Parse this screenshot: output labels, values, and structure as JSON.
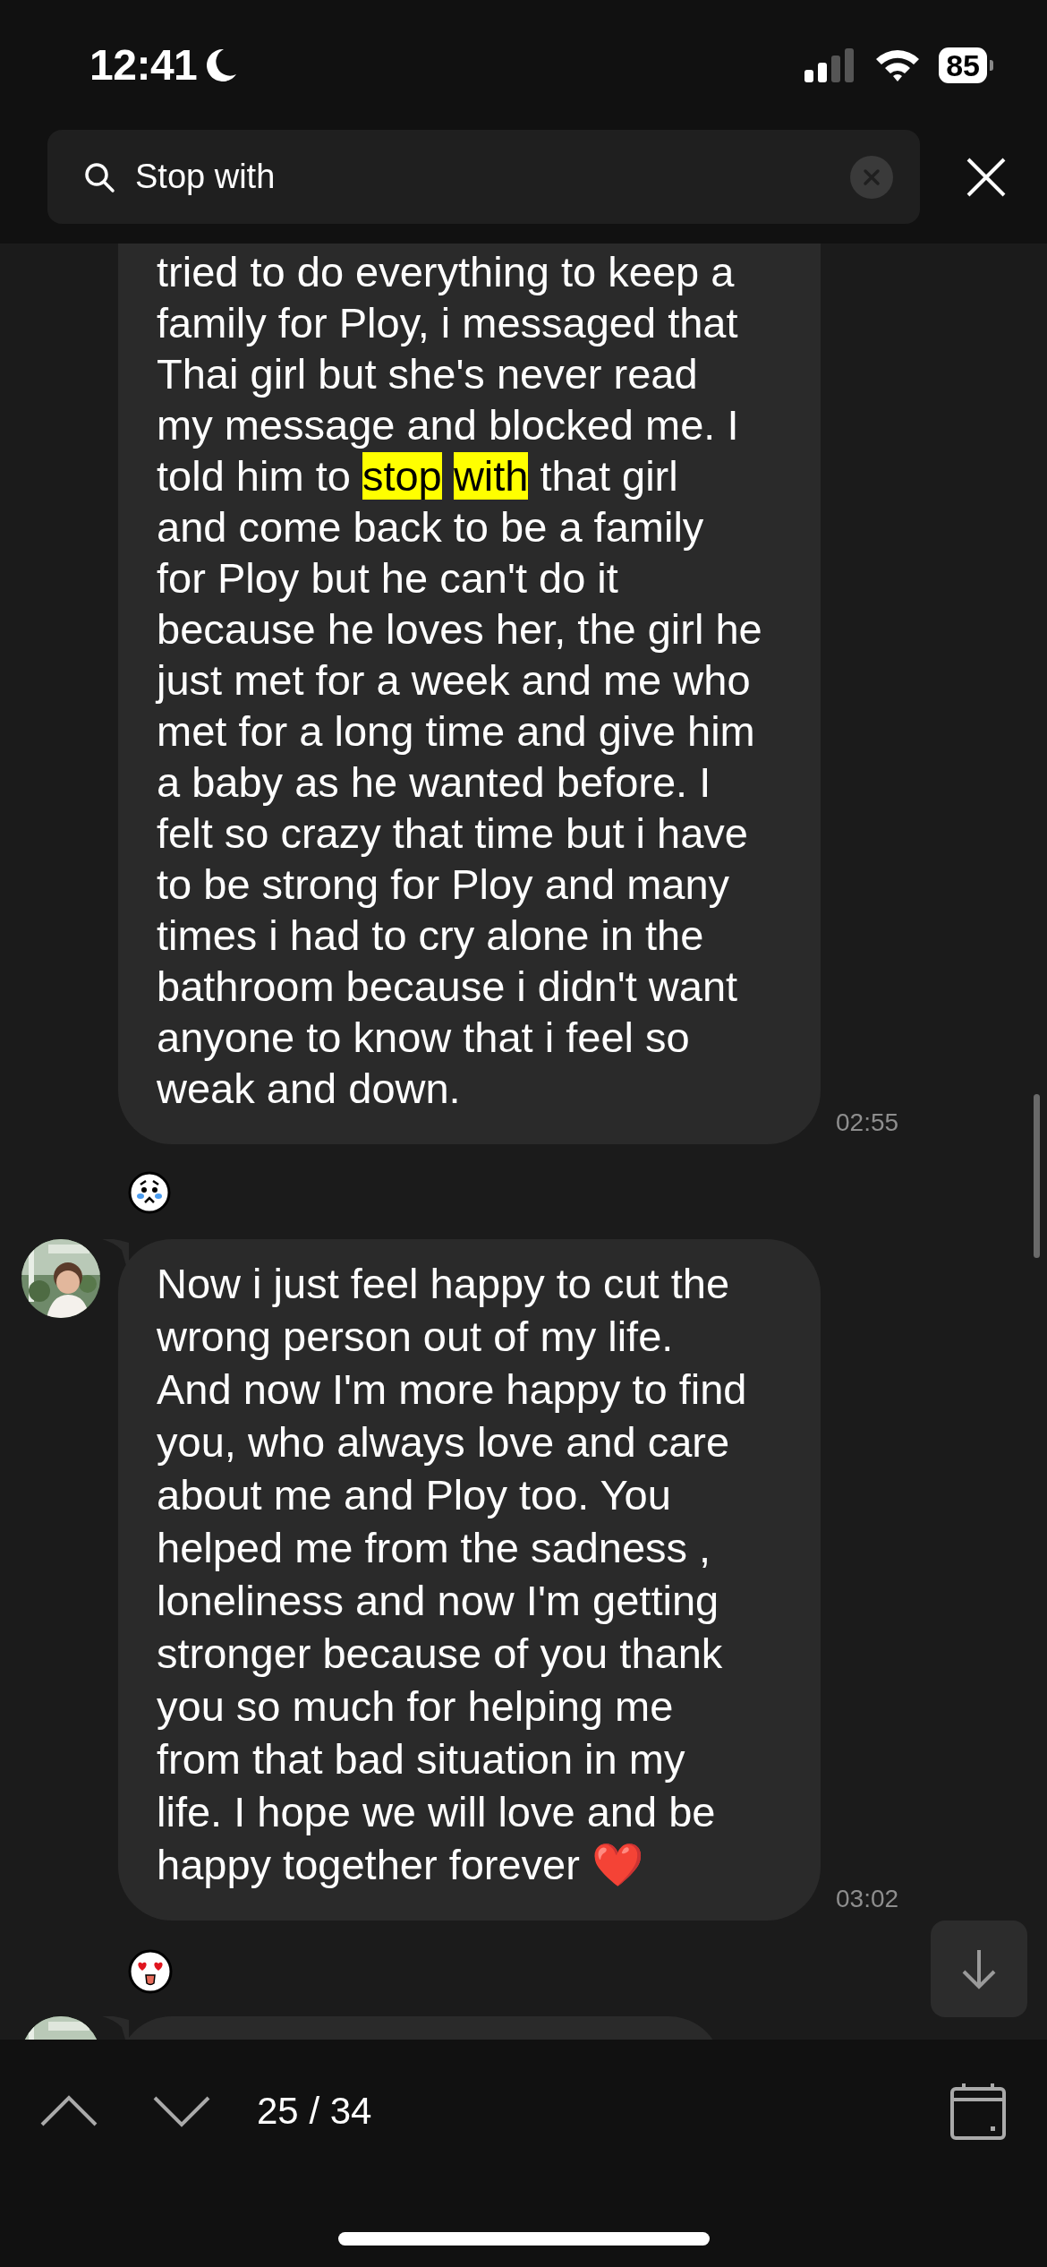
{
  "status_bar": {
    "time": "12:41",
    "battery": "85"
  },
  "search": {
    "value": "Stop with"
  },
  "messages": [
    {
      "kind": "full",
      "avatar": false,
      "time": "02:55",
      "reaction": {
        "kind": "crying"
      },
      "segments": [
        {
          "text": "tried to do everything to keep a\nfamily for Ploy, i messaged that\nThai girl but she's never read\nmy message and blocked me. I\ntold him to ",
          "highlighted": false
        },
        {
          "text": "stop",
          "highlighted": true
        },
        {
          "text": "with",
          "highlighted": true
        },
        {
          "text": " that girl\nand come back to be a family\nfor Ploy but he can't do it\nbecause he loves her, the girl he\njust met for a week and me who\nmet for a long time and give him\na baby as he wanted before. I\nfelt so crazy that time but i have\nto be strong for Ploy and many\ntimes i had to cry alone in the\nbathroom because i didn't want\nanyone to know that i feel so\nweak and down.",
          "highlighted": false
        }
      ]
    },
    {
      "kind": "full",
      "avatar": true,
      "time": "03:02",
      "reaction": {
        "kind": "heart_eyes"
      },
      "segments": [
        {
          "text": "Now i just feel happy to cut the\nwrong person out of my life.\nAnd now I'm more happy to find\nyou, who always love and care\nabout me and Ploy too. You\nhelped me from the sadness ,\nloneliness and now I'm getting\nstronger because of you thank\nyou so much for helping me\nfrom that bad situation in my\nlife. I hope we will love and be\nhappy together forever ❤️",
          "highlighted": false
        }
      ]
    },
    {
      "kind": "cut_off",
      "avatar": true
    }
  ],
  "footer": {
    "counter": "25 / 34"
  }
}
